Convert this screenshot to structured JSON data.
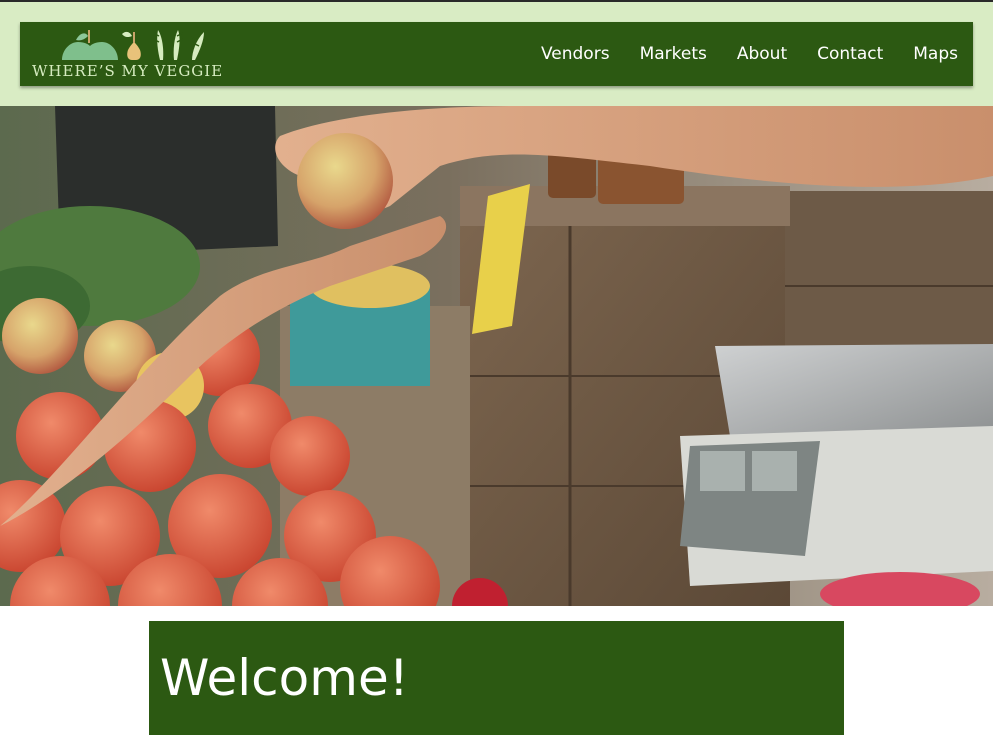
{
  "site": {
    "logo_text": "WHERE’S MY VEGGIE"
  },
  "nav": {
    "items": [
      {
        "label": "Vendors"
      },
      {
        "label": "Markets"
      },
      {
        "label": "About"
      },
      {
        "label": "Contact"
      },
      {
        "label": "Maps"
      }
    ]
  },
  "main": {
    "welcome_title": "Welcome!"
  },
  "colors": {
    "header_band": "#d9ecc4",
    "brand_green": "#2c5912",
    "logo_text": "#d6ecc0"
  },
  "hero_image": {
    "alt": "hero-photo-farmers-market"
  }
}
